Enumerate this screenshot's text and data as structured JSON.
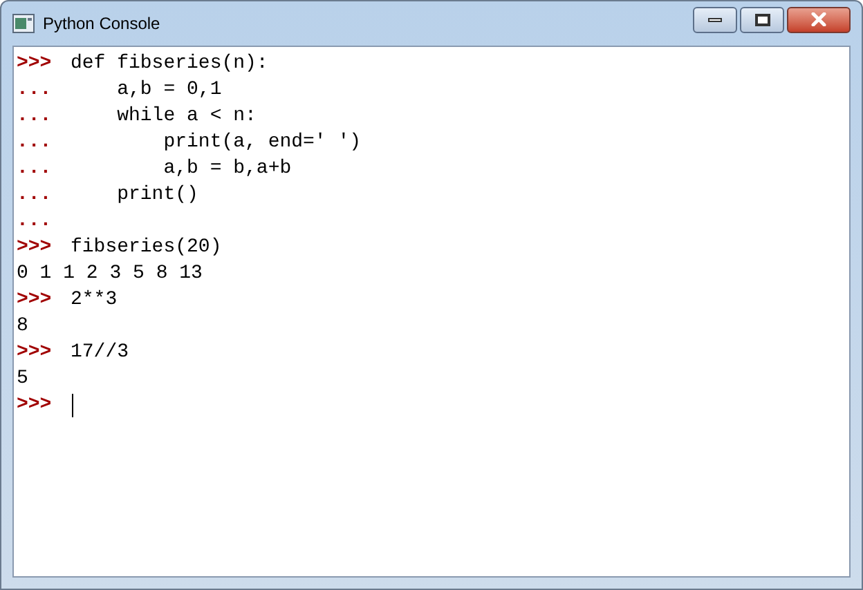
{
  "window": {
    "title": "Python Console"
  },
  "lines": [
    {
      "kind": "input",
      "prompt": ">>>",
      "text": "def fibseries(n):"
    },
    {
      "kind": "input",
      "prompt": "...",
      "text": "    a,b = 0,1"
    },
    {
      "kind": "input",
      "prompt": "...",
      "text": "    while a < n:"
    },
    {
      "kind": "input",
      "prompt": "...",
      "text": "        print(a, end=' ')"
    },
    {
      "kind": "input",
      "prompt": "...",
      "text": "        a,b = b,a+b"
    },
    {
      "kind": "input",
      "prompt": "...",
      "text": "    print()"
    },
    {
      "kind": "input",
      "prompt": "..."
    },
    {
      "kind": "input",
      "prompt": ">>>",
      "text": "fibseries(20)"
    },
    {
      "kind": "output",
      "text": "0 1 1 2 3 5 8 13"
    },
    {
      "kind": "input",
      "prompt": ">>>",
      "text": "2**3"
    },
    {
      "kind": "output",
      "text": "8"
    },
    {
      "kind": "input",
      "prompt": ">>>",
      "text": "17//3"
    },
    {
      "kind": "output",
      "text": "5"
    },
    {
      "kind": "active",
      "prompt": ">>>"
    }
  ]
}
